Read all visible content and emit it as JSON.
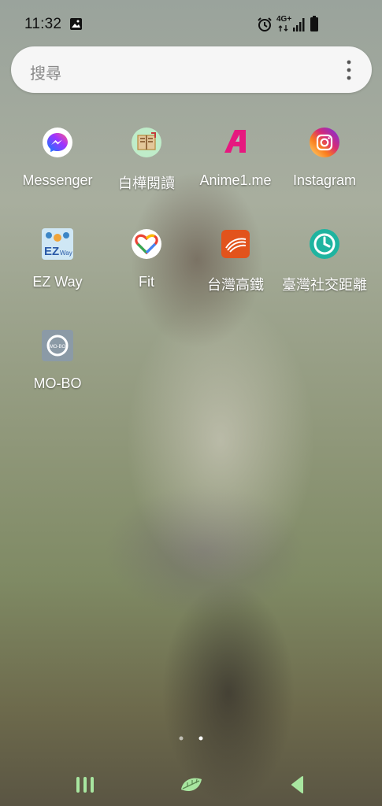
{
  "status_bar": {
    "time": "11:32",
    "network": "4G+",
    "icons": [
      "image-icon",
      "alarm-icon",
      "network-arrows-icon",
      "signal-icon",
      "battery-icon"
    ]
  },
  "search": {
    "placeholder": "搜尋"
  },
  "apps": [
    {
      "label": "Messenger",
      "icon": "messenger-icon"
    },
    {
      "label": "白樺閱讀",
      "icon": "book-icon"
    },
    {
      "label": "Anime1.me",
      "icon": "anime1-icon"
    },
    {
      "label": "Instagram",
      "icon": "instagram-icon"
    },
    {
      "label": "EZ Way",
      "icon": "ez-way-icon"
    },
    {
      "label": "Fit",
      "icon": "fit-heart-icon"
    },
    {
      "label": "台灣高鐵",
      "icon": "thsr-icon"
    },
    {
      "label": "臺灣社交距離",
      "icon": "social-distance-icon"
    },
    {
      "label": "MO-BO",
      "icon": "mobo-icon"
    }
  ],
  "page_indicator": {
    "pages": 2,
    "current": 2
  },
  "nav": {
    "recent": "recent-apps-icon",
    "home": "home-icon",
    "back": "back-icon",
    "accent": "#a8e6a0"
  }
}
